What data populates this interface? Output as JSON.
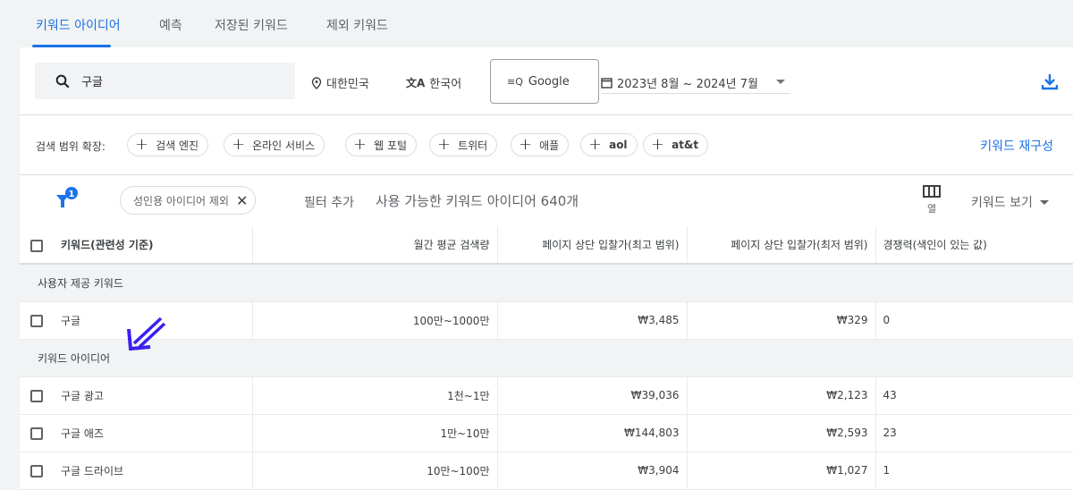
{
  "tabs": [
    {
      "label": "키워드 아이디어",
      "active": true
    },
    {
      "label": "예측"
    },
    {
      "label": "저장된 키워드"
    },
    {
      "label": "제외 키워드"
    }
  ],
  "search": {
    "value": "구글"
  },
  "location": "대한민국",
  "language": "한국어",
  "network": "Google",
  "date_range": "2023년 8월 ~ 2024년 7월",
  "expand": {
    "label": "검색 범위 확장:",
    "chips": [
      "검색 엔진",
      "온라인 서비스",
      "웹 포털",
      "트위터",
      "애플",
      "aol",
      "at&t"
    ],
    "refine": "키워드 재구성"
  },
  "filter": {
    "count": "1",
    "chip": "성인용 아이디어 제외",
    "add": "필터 추가",
    "available": "사용 가능한 키워드 아이디어 640개",
    "columns_label": "열",
    "view": "키워드 보기"
  },
  "table": {
    "headers": [
      "키워드(관련성 기준)",
      "월간 평균 검색량",
      "페이지 상단 입찰가(최고 범위)",
      "페이지 상단 입찰가(최저 범위)",
      "경쟁력(색인이 있는 값)"
    ],
    "groups": [
      {
        "label": "사용자 제공 키워드",
        "rows": [
          [
            "구글",
            "100만~1000만",
            "₩3,485",
            "₩329",
            "0"
          ]
        ]
      },
      {
        "label": "키워드 아이디어",
        "rows": [
          [
            "구글 광고",
            "1천~1만",
            "₩39,036",
            "₩2,123",
            "43"
          ],
          [
            "구글 애즈",
            "1만~10만",
            "₩144,803",
            "₩2,593",
            "23"
          ],
          [
            "구글 드라이브",
            "10만~100만",
            "₩3,904",
            "₩1,027",
            "1"
          ]
        ]
      }
    ]
  },
  "colors": {
    "accent": "#1a73e8",
    "annotation_arrow": "#3a1ff0"
  }
}
